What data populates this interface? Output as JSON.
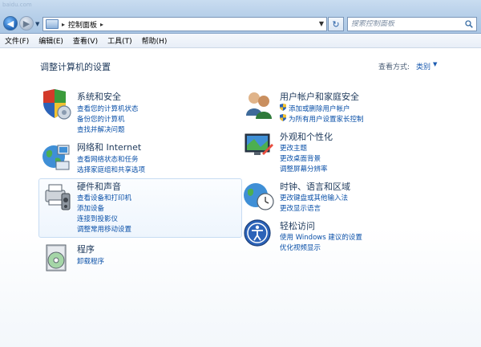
{
  "watermark": "baidu.com",
  "address": {
    "path_root": "控制面板",
    "separator": "▸"
  },
  "search": {
    "placeholder": "搜索控制面板"
  },
  "menu": [
    "文件(F)",
    "编辑(E)",
    "查看(V)",
    "工具(T)",
    "帮助(H)"
  ],
  "page": {
    "title": "调整计算机的设置",
    "view_by_label": "查看方式:",
    "view_by_value": "类别"
  },
  "categories": {
    "system": {
      "title": "系统和安全",
      "links": [
        "查看您的计算机状态",
        "备份您的计算机",
        "查找并解决问题"
      ]
    },
    "network": {
      "title": "网络和 Internet",
      "links": [
        "查看网络状态和任务",
        "选择家庭组和共享选项"
      ]
    },
    "hardware": {
      "title": "硬件和声音",
      "links": [
        "查看设备和打印机",
        "添加设备",
        "连接到投影仪",
        "调整常用移动设置"
      ]
    },
    "programs": {
      "title": "程序",
      "links": [
        "卸载程序"
      ]
    },
    "users": {
      "title": "用户帐户和家庭安全",
      "links": [
        "添加或删除用户帐户",
        "为所有用户设置家长控制"
      ]
    },
    "appearance": {
      "title": "外观和个性化",
      "links": [
        "更改主题",
        "更改桌面背景",
        "调整屏幕分辨率"
      ]
    },
    "clock": {
      "title": "时钟、语言和区域",
      "links": [
        "更改键盘或其他输入法",
        "更改显示语言"
      ]
    },
    "ease": {
      "title": "轻松访问",
      "links": [
        "使用 Windows 建议的设置",
        "优化视频显示"
      ]
    }
  }
}
